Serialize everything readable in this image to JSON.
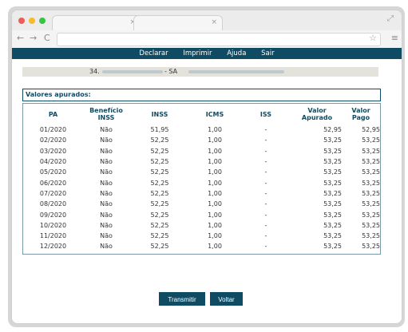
{
  "browser": {
    "nav_back": "←",
    "nav_forward": "→",
    "nav_reload": "C",
    "star": "☆",
    "menu": "≡",
    "tab_close": "×",
    "resize": "⤢"
  },
  "navbar": {
    "items": [
      "Declarar",
      "Imprimir",
      "Ajuda",
      "Sair"
    ]
  },
  "company": {
    "cnpj_prefix": "34.",
    "separator": "- SA"
  },
  "section": {
    "title": "Valores apurados:"
  },
  "table": {
    "headers": {
      "pa": "PA",
      "beneficio_1": "Benefício",
      "beneficio_2": "INSS",
      "inss": "INSS",
      "icms": "ICMS",
      "iss": "ISS",
      "valor_apurado_1": "Valor",
      "valor_apurado_2": "Apurado",
      "valor_pago_1": "Valor",
      "valor_pago_2": "Pago"
    },
    "rows": [
      {
        "pa": "01/2020",
        "beneficio": "Não",
        "inss": "51,95",
        "icms": "1,00",
        "iss": "-",
        "valor_apurado": "52,95",
        "valor_pago": "52,95"
      },
      {
        "pa": "02/2020",
        "beneficio": "Não",
        "inss": "52,25",
        "icms": "1,00",
        "iss": "-",
        "valor_apurado": "53,25",
        "valor_pago": "53,25"
      },
      {
        "pa": "03/2020",
        "beneficio": "Não",
        "inss": "52,25",
        "icms": "1,00",
        "iss": "-",
        "valor_apurado": "53,25",
        "valor_pago": "53,25"
      },
      {
        "pa": "04/2020",
        "beneficio": "Não",
        "inss": "52,25",
        "icms": "1,00",
        "iss": "-",
        "valor_apurado": "53,25",
        "valor_pago": "53,25"
      },
      {
        "pa": "05/2020",
        "beneficio": "Não",
        "inss": "52,25",
        "icms": "1,00",
        "iss": "-",
        "valor_apurado": "53,25",
        "valor_pago": "53,25"
      },
      {
        "pa": "06/2020",
        "beneficio": "Não",
        "inss": "52,25",
        "icms": "1,00",
        "iss": "-",
        "valor_apurado": "53,25",
        "valor_pago": "53,25"
      },
      {
        "pa": "07/2020",
        "beneficio": "Não",
        "inss": "52,25",
        "icms": "1,00",
        "iss": "-",
        "valor_apurado": "53,25",
        "valor_pago": "53,25"
      },
      {
        "pa": "08/2020",
        "beneficio": "Não",
        "inss": "52,25",
        "icms": "1,00",
        "iss": "-",
        "valor_apurado": "53,25",
        "valor_pago": "53,25"
      },
      {
        "pa": "09/2020",
        "beneficio": "Não",
        "inss": "52,25",
        "icms": "1,00",
        "iss": "-",
        "valor_apurado": "53,25",
        "valor_pago": "53,25"
      },
      {
        "pa": "10/2020",
        "beneficio": "Não",
        "inss": "52,25",
        "icms": "1,00",
        "iss": "-",
        "valor_apurado": "53,25",
        "valor_pago": "53,25"
      },
      {
        "pa": "11/2020",
        "beneficio": "Não",
        "inss": "52,25",
        "icms": "1,00",
        "iss": "-",
        "valor_apurado": "53,25",
        "valor_pago": "53,25"
      },
      {
        "pa": "12/2020",
        "beneficio": "Não",
        "inss": "52,25",
        "icms": "1,00",
        "iss": "-",
        "valor_apurado": "53,25",
        "valor_pago": "53,25"
      }
    ]
  },
  "buttons": {
    "transmitir": "Transmitir",
    "voltar": "Voltar"
  }
}
